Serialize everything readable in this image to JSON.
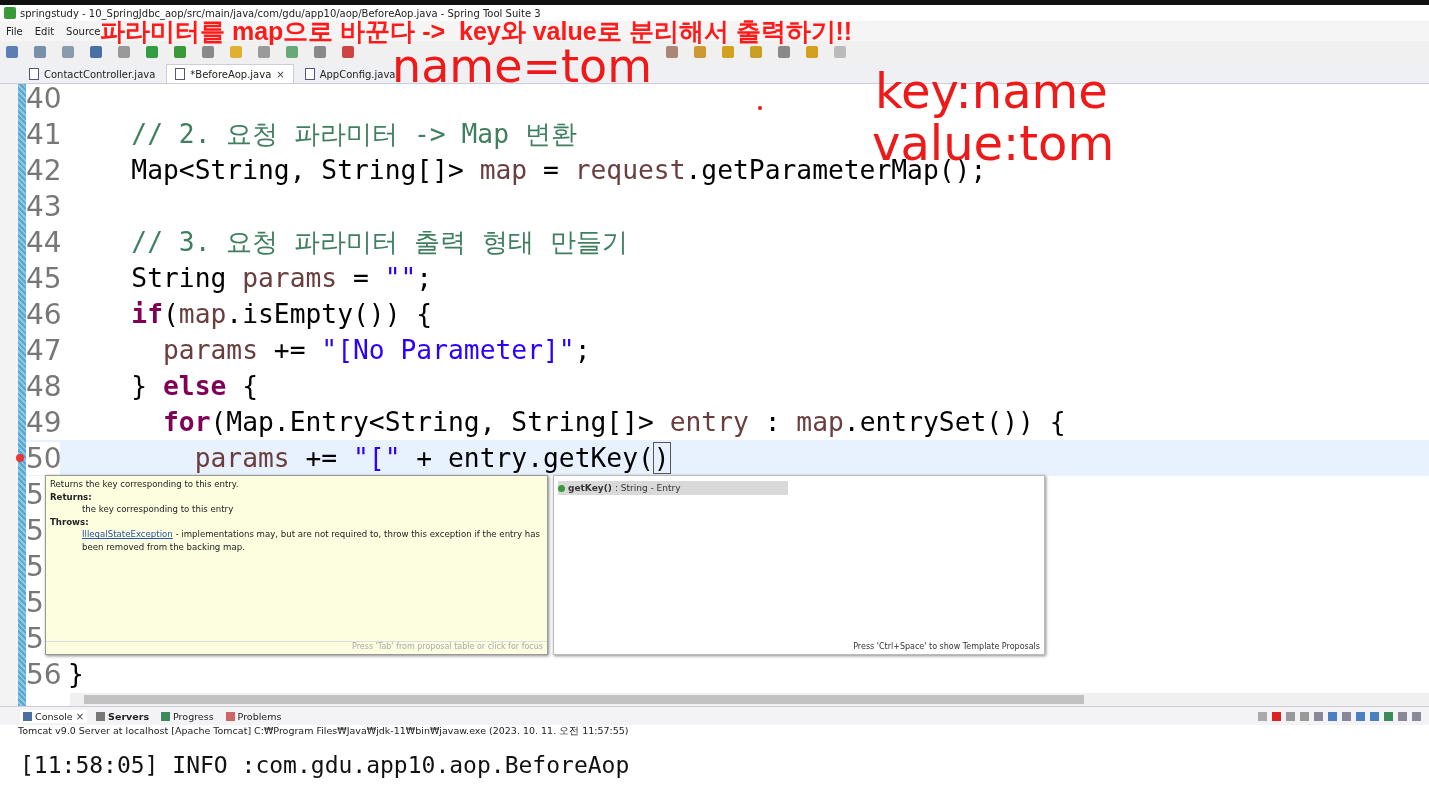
{
  "window": {
    "title": "springstudy - 10_SpringJdbc_aop/src/main/java/com/gdu/app10/aop/BeforeAop.java - Spring Tool Suite 3"
  },
  "menu": [
    "File",
    "Edit",
    "Source"
  ],
  "editor_tabs": [
    {
      "label": "ContactController.java",
      "selected": false
    },
    {
      "label": "*BeforeAop.java",
      "selected": true,
      "close": "×"
    },
    {
      "label": "AppConfig.java",
      "selected": false
    }
  ],
  "code_lines": [
    {
      "number": "40",
      "current": false,
      "error": false
    },
    {
      "number": "41",
      "current": false,
      "error": false,
      "tokens": [
        {
          "kind": "comment",
          "text": "    // 2. 요청 파라미터 -> Map 변환"
        }
      ]
    },
    {
      "number": "42",
      "current": false,
      "error": false,
      "tokens": [
        {
          "kind": "plain",
          "text": "    Map<String, String[]> "
        },
        {
          "kind": "variable",
          "text": "map"
        },
        {
          "kind": "plain",
          "text": " = "
        },
        {
          "kind": "variable",
          "text": "request"
        },
        {
          "kind": "plain",
          "text": ".getParameterMap();"
        }
      ]
    },
    {
      "number": "43",
      "current": false,
      "error": false
    },
    {
      "number": "44",
      "current": false,
      "error": false,
      "tokens": [
        {
          "kind": "comment",
          "text": "    // 3. 요청 파라미터 출력 형태 만들기"
        }
      ]
    },
    {
      "number": "45",
      "current": false,
      "error": false,
      "tokens": [
        {
          "kind": "plain",
          "text": "    String "
        },
        {
          "kind": "variable",
          "text": "params"
        },
        {
          "kind": "plain",
          "text": " = "
        },
        {
          "kind": "string",
          "text": "\"\""
        },
        {
          "kind": "plain",
          "text": ";"
        }
      ]
    },
    {
      "number": "46",
      "current": false,
      "error": false,
      "tokens": [
        {
          "kind": "keyword",
          "text": "    if"
        },
        {
          "kind": "plain",
          "text": "("
        },
        {
          "kind": "variable",
          "text": "map"
        },
        {
          "kind": "plain",
          "text": ".isEmpty()) {"
        }
      ]
    },
    {
      "number": "47",
      "current": false,
      "error": false,
      "tokens": [
        {
          "kind": "variable",
          "text": "      params"
        },
        {
          "kind": "plain",
          "text": " += "
        },
        {
          "kind": "string",
          "text": "\"[No Parameter]\""
        },
        {
          "kind": "plain",
          "text": ";"
        }
      ]
    },
    {
      "number": "48",
      "current": false,
      "error": false,
      "tokens": [
        {
          "kind": "plain",
          "text": "    } "
        },
        {
          "kind": "keyword",
          "text": "else"
        },
        {
          "kind": "plain",
          "text": " {"
        }
      ]
    },
    {
      "number": "49",
      "current": false,
      "error": false,
      "tokens": [
        {
          "kind": "keyword",
          "text": "      for"
        },
        {
          "kind": "plain",
          "text": "(Map.Entry<String, String[]> "
        },
        {
          "kind": "variable",
          "text": "entry"
        },
        {
          "kind": "plain",
          "text": " : "
        },
        {
          "kind": "variable",
          "text": "map"
        },
        {
          "kind": "plain",
          "text": ".entrySet()) {"
        }
      ]
    },
    {
      "number": "50",
      "current": true,
      "error": true,
      "tokens": [
        {
          "kind": "variable",
          "text": "        params"
        },
        {
          "kind": "plain",
          "text": " += "
        },
        {
          "kind": "string",
          "text": "\"[\""
        },
        {
          "kind": "plain",
          "text": " + entry.getKey("
        },
        {
          "kind": "matched",
          "text": ")"
        }
      ]
    },
    {
      "number": "5",
      "current": false,
      "error": false
    },
    {
      "number": "5",
      "current": false,
      "error": false
    },
    {
      "number": "5",
      "current": false,
      "error": false
    },
    {
      "number": "5",
      "current": false,
      "error": false
    },
    {
      "number": "5",
      "current": false,
      "error": false
    },
    {
      "number": "56",
      "current": false,
      "error": false,
      "tokens": [
        {
          "kind": "plain",
          "text": "}"
        }
      ]
    }
  ],
  "doc_popup": {
    "summary": "Returns the key corresponding to this entry.",
    "sections": [
      {
        "heading": "Returns:",
        "body": "the key corresponding to this entry"
      },
      {
        "heading": "Throws:",
        "link": "IllegalStateException",
        "body": " - implementations may, but are not required to, throw this exception if the entry has been removed from the backing map."
      }
    ],
    "footer": "Press 'Tab' from proposal table or click for focus"
  },
  "proposals": {
    "items": [
      {
        "name": "getKey()",
        "detail": " : String - Entry",
        "selected": true
      }
    ],
    "footer": "Press 'Ctrl+Space' to show Template Proposals"
  },
  "panel_tabs": [
    {
      "label": "Console",
      "selected": true,
      "bold": false,
      "close": "×"
    },
    {
      "label": "Servers",
      "selected": false,
      "bold": true
    },
    {
      "label": "Progress",
      "selected": false,
      "bold": false
    },
    {
      "label": "Problems",
      "selected": false,
      "bold": false
    }
  ],
  "console": {
    "process": "Tomcat v9.0 Server at localhost [Apache Tomcat] C:₩Program Files₩Java₩jdk-11₩bin₩javaw.exe  (2023. 10. 11. 오전 11:57:55)",
    "output": "[11:58:05] INFO :com.gdu.app10.aop.BeforeAop"
  },
  "annotations": {
    "headline": "파라미터를 map으로 바꾼다 ->  key와 value로 분리해서 출력하기!!",
    "example": "name=tom",
    "key_line": "key:name",
    "value_line": "value:tom"
  }
}
